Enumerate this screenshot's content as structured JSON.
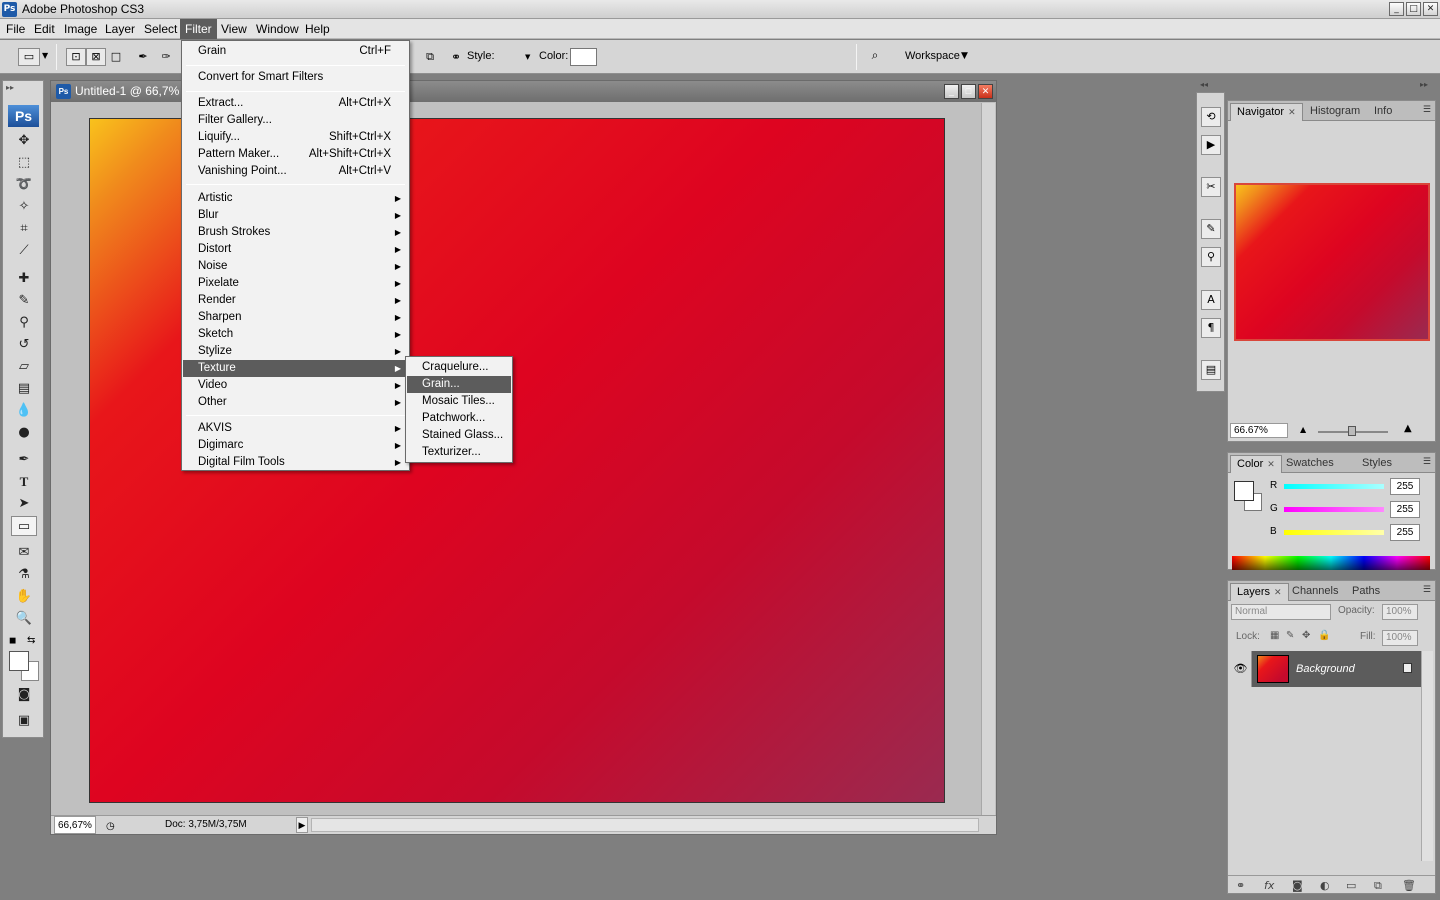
{
  "app": {
    "title": "Adobe Photoshop CS3",
    "icon_text": "Ps"
  },
  "window_controls": {
    "minimize": "_",
    "maximize": "□",
    "close": "✕"
  },
  "menubar": [
    "File",
    "Edit",
    "Image",
    "Layer",
    "Select",
    "Filter",
    "View",
    "Window",
    "Help"
  ],
  "menubar_active": "Filter",
  "options_bar": {
    "style_label": "Style:",
    "color_label": "Color:",
    "style_swatch": "#d01020",
    "workspace_label": "Workspace",
    "workspace_arrow": "▼"
  },
  "toolbox": {
    "logo": "Ps",
    "tools": [
      "move-icon",
      "marquee-icon",
      "lasso-icon",
      "magic-wand-icon",
      "crop-icon",
      "slice-icon",
      "healing-brush-icon",
      "brush-icon",
      "clone-stamp-icon",
      "history-brush-icon",
      "eraser-icon",
      "gradient-icon",
      "blur-icon",
      "dodge-icon",
      "pen-icon",
      "type-icon",
      "path-selection-icon",
      "rectangle-icon",
      "notes-icon",
      "eyedropper-icon",
      "hand-icon",
      "zoom-icon"
    ]
  },
  "document": {
    "title": "Untitled-1 @ 66,7%",
    "zoom": "66,67%",
    "doc_info": "Doc: 3,75M/3,75M",
    "status_arrow": "▶"
  },
  "filter_menu": {
    "last_filter": {
      "label": "Grain",
      "shortcut": "Ctrl+F"
    },
    "smart": "Convert for Smart Filters",
    "special": [
      {
        "label": "Extract...",
        "shortcut": "Alt+Ctrl+X"
      },
      {
        "label": "Filter Gallery...",
        "shortcut": ""
      },
      {
        "label": "Liquify...",
        "shortcut": "Shift+Ctrl+X"
      },
      {
        "label": "Pattern Maker...",
        "shortcut": "Alt+Shift+Ctrl+X"
      },
      {
        "label": "Vanishing Point...",
        "shortcut": "Alt+Ctrl+V"
      }
    ],
    "categories": [
      "Artistic",
      "Blur",
      "Brush Strokes",
      "Distort",
      "Noise",
      "Pixelate",
      "Render",
      "Sharpen",
      "Sketch",
      "Stylize",
      "Texture",
      "Video",
      "Other"
    ],
    "highlighted": "Texture",
    "plugins": [
      "AKVIS",
      "Digimarc",
      "Digital Film Tools"
    ],
    "submenu_arrow": "▶"
  },
  "texture_submenu": {
    "items": [
      "Craquelure...",
      "Grain...",
      "Mosaic Tiles...",
      "Patchwork...",
      "Stained Glass...",
      "Texturizer..."
    ],
    "highlighted": "Grain..."
  },
  "navigator_panel": {
    "tabs": [
      "Navigator",
      "Histogram",
      "Info"
    ],
    "zoom": "66.67%"
  },
  "color_panel": {
    "tabs": [
      "Color",
      "Swatches",
      "Styles"
    ],
    "channels": [
      {
        "name": "R",
        "value": "255"
      },
      {
        "name": "G",
        "value": "255"
      },
      {
        "name": "B",
        "value": "255"
      }
    ]
  },
  "layers_panel": {
    "tabs": [
      "Layers",
      "Channels",
      "Paths"
    ],
    "blend_mode": "Normal",
    "opacity_label": "Opacity:",
    "opacity": "100%",
    "lock_label": "Lock:",
    "fill_label": "Fill:",
    "fill": "100%",
    "layers": [
      {
        "name": "Background",
        "visible": true,
        "locked": true
      }
    ]
  },
  "colors": {
    "menu_highlight": "#5c5c5c",
    "workspace_bg": "#7f7f7f",
    "gradient_start": "#f9c21c",
    "gradient_mid": "#de0420",
    "gradient_end": "#9a2a50"
  }
}
